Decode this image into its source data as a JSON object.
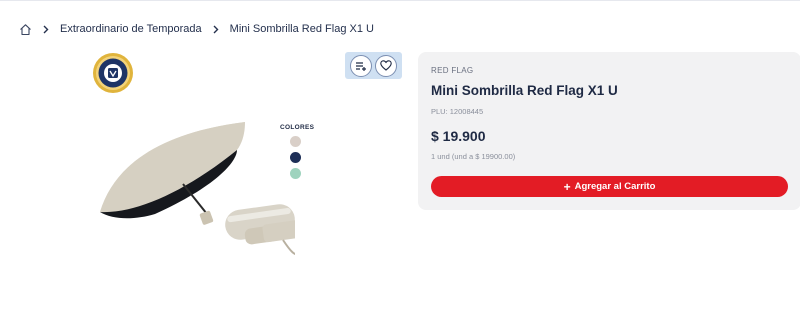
{
  "breadcrumb": {
    "home_icon": "home-icon",
    "items": [
      "Extraordinario de Temporada"
    ],
    "current": "Mini Sombrilla Red Flag X1 U"
  },
  "media": {
    "badge_icon": "seal-badge-icon",
    "action_icons": [
      "add-to-list-icon",
      "heart-icon"
    ],
    "colors_label": "COLORES",
    "color_swatches": [
      "#d9cfc8",
      "#1e2f57",
      "#9fd3be"
    ]
  },
  "product": {
    "brand": "RED FLAG",
    "title": "Mini Sombrilla Red Flag X1 U",
    "plu": "PLU: 12008445",
    "price": "$ 19.900",
    "unit_price": "1 und (und a $ 19900.00)",
    "add_to_cart_label": "Agregar al Carrito",
    "add_to_cart_icon": "plus-icon"
  },
  "colors": {
    "accent_red": "#e31c25",
    "navy": "#1f2a44",
    "panel_bg": "#f2f2f3"
  }
}
